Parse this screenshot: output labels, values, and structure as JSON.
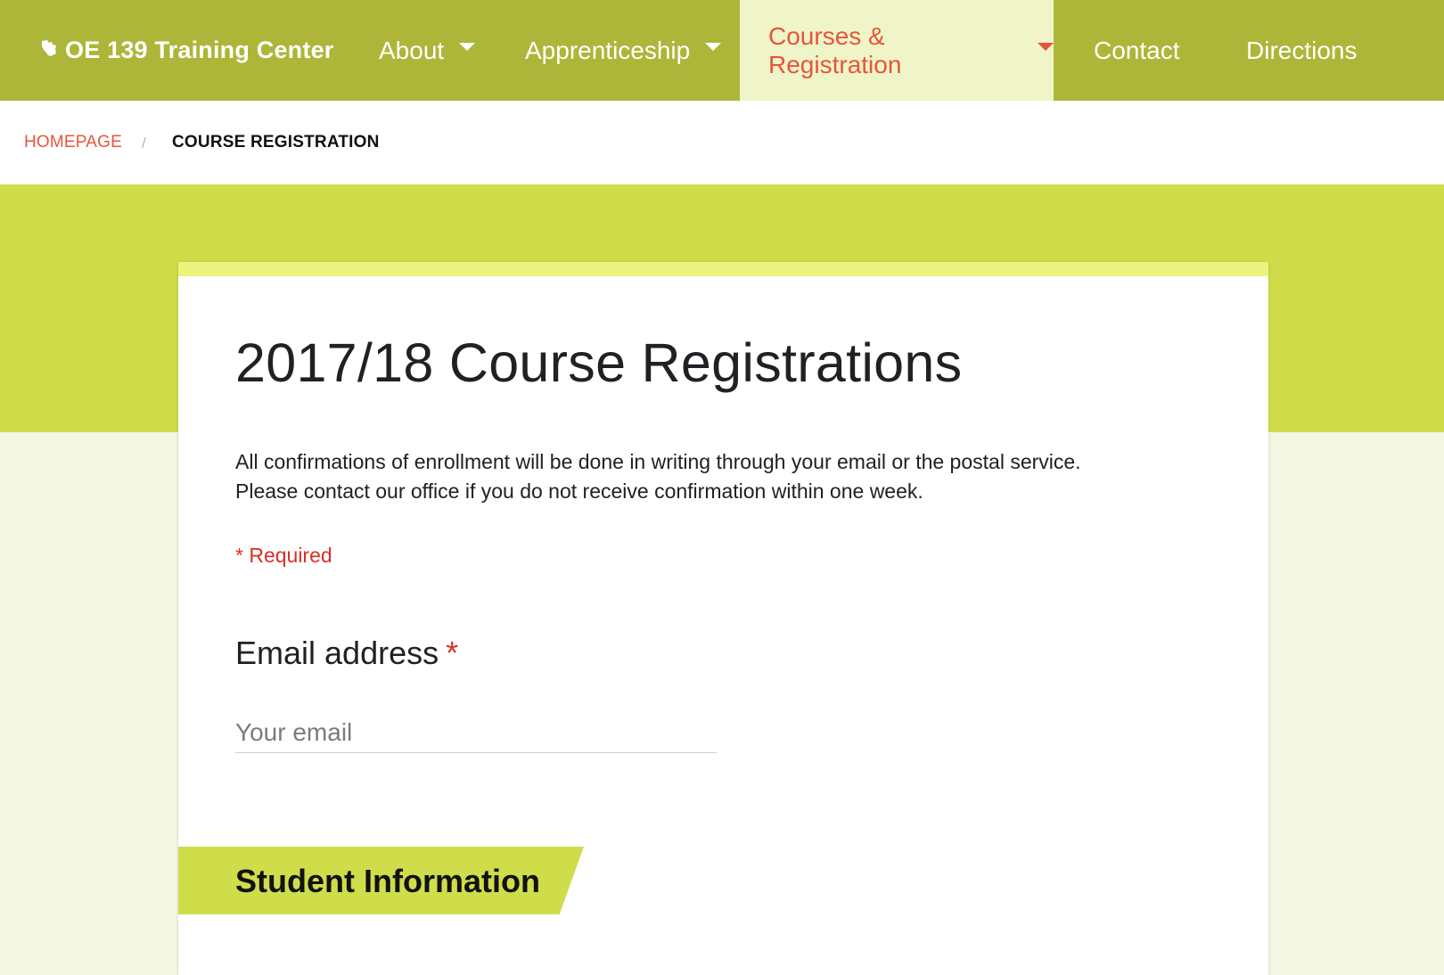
{
  "nav": {
    "brand": "OE 139 Training Center",
    "brand_icon": "wisconsin-map-icon",
    "items": [
      {
        "label": "About",
        "has_dropdown": true,
        "active": false
      },
      {
        "label": "Apprenticeship",
        "has_dropdown": true,
        "active": false
      },
      {
        "label": "Courses & Registration",
        "has_dropdown": true,
        "active": true
      },
      {
        "label": "Contact",
        "has_dropdown": false,
        "active": false
      },
      {
        "label": "Directions",
        "has_dropdown": false,
        "active": false
      }
    ]
  },
  "breadcrumb": {
    "home": "HOMEPAGE",
    "separator": "/",
    "current": "COURSE REGISTRATION"
  },
  "form": {
    "title": "2017/18 Course Registrations",
    "description": [
      "All confirmations of enrollment will be done in writing through your email or the postal service.",
      "Please contact our office if you do not receive confirmation within one week."
    ],
    "required_note": "* Required",
    "email": {
      "label": "Email address",
      "required_mark": "*",
      "placeholder": "Your email",
      "value": ""
    },
    "section_title": "Student Information"
  },
  "colors": {
    "nav_bg": "#adb638",
    "nav_active_bg": "#eff5c8",
    "accent_red": "#e8553a",
    "hero_green": "#cedd49",
    "card_accent": "#eef37d",
    "required_red": "#d93025",
    "page_bg": "#f4f7e4"
  }
}
